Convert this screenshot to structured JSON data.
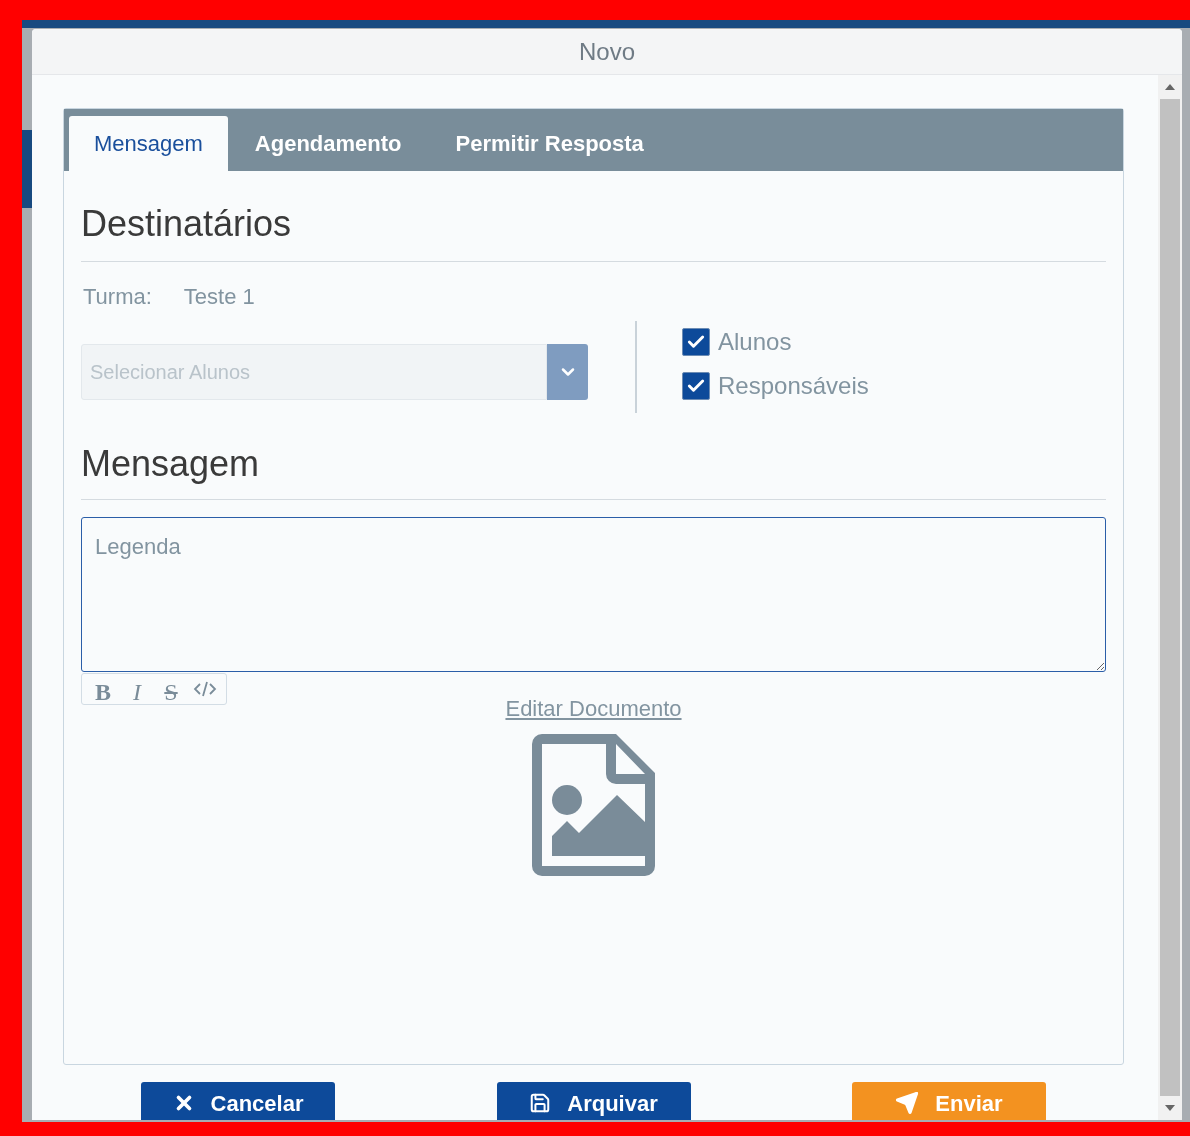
{
  "window": {
    "title": "Novo"
  },
  "tabs": [
    {
      "label": "Mensagem",
      "selected": true
    },
    {
      "label": "Agendamento",
      "selected": false
    },
    {
      "label": "Permitir Resposta",
      "selected": false
    }
  ],
  "recipients": {
    "heading": "Destinatários",
    "class_label": "Turma:",
    "class_value": "Teste 1",
    "select": {
      "placeholder": "Selecionar Alunos"
    },
    "checkboxes": [
      {
        "label": "Alunos",
        "checked": true
      },
      {
        "label": "Responsáveis",
        "checked": true
      }
    ]
  },
  "message": {
    "heading": "Mensagem",
    "caption": {
      "placeholder": "Legenda"
    },
    "toolbar": [
      {
        "kind": "bold",
        "label": "B"
      },
      {
        "kind": "italic",
        "label": "I"
      },
      {
        "kind": "strike",
        "label": "S"
      },
      {
        "kind": "code"
      }
    ],
    "edit_link": "Editar Documento"
  },
  "buttons": [
    {
      "kind": "cancel",
      "label": "Cancelar"
    },
    {
      "kind": "archive",
      "label": "Arquivar"
    },
    {
      "kind": "send",
      "label": "Enviar"
    }
  ]
}
